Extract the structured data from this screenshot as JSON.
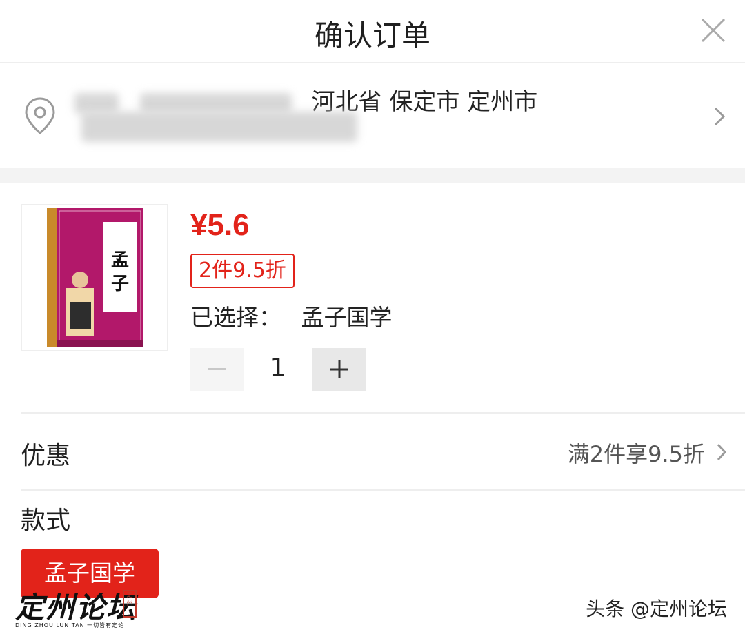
{
  "header": {
    "title": "确认订单",
    "close_icon": "close-icon"
  },
  "address": {
    "region": "河北省 保定市 定州市",
    "icon": "location-pin-icon",
    "chevron": "chevron-right-icon"
  },
  "product": {
    "price": "¥5.6",
    "discount_tag": "2件9.5折",
    "selected_label": "已选择：",
    "selected_value": "孟子国学",
    "quantity": "1",
    "cover_title": "孟子",
    "accent_color": "#e2231a"
  },
  "promotion": {
    "label": "优惠",
    "value": "满2件享9.5折"
  },
  "style": {
    "label": "款式",
    "options": [
      "孟子国学"
    ]
  },
  "watermark": {
    "logo": "定州论坛",
    "sub": "DING ZHOU LUN TAN 一切皆有定论",
    "seal": "定州",
    "credit": "头条 @定州论坛"
  }
}
